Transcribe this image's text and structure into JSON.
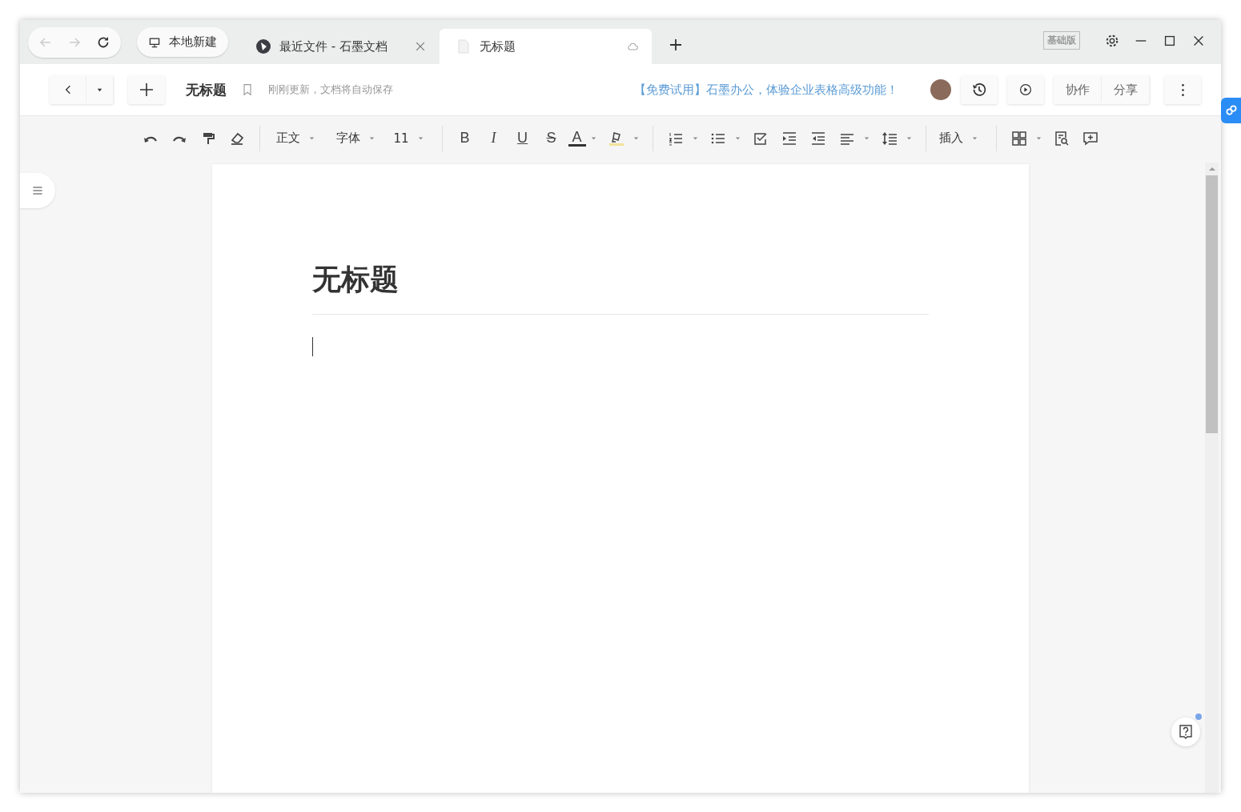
{
  "browser": {
    "home_button": "本地新建",
    "tabs": [
      {
        "title": "最近文件 - 石墨文档",
        "kind": "app",
        "selected": false
      },
      {
        "title": "无标题",
        "kind": "doc",
        "selected": true
      }
    ],
    "edition_badge": "基础版"
  },
  "doc_header": {
    "title": "无标题",
    "save_status": "刚刚更新，文档将自动保存",
    "promo": "【免费试用】石墨办公，体验企业表格高级功能！",
    "buttons": [
      "协作",
      "分享"
    ]
  },
  "toolbar": {
    "style_dropdown": "正文",
    "font_dropdown": "字体",
    "size_dropdown": "11",
    "format_buttons": [
      {
        "label": "B",
        "kind": "bold"
      },
      {
        "label": "I",
        "kind": "italic"
      },
      {
        "label": "U",
        "kind": "underline"
      },
      {
        "label": "S",
        "kind": "strike"
      },
      {
        "label": "A",
        "kind": "color"
      }
    ],
    "insert_dropdown": "插入"
  },
  "document": {
    "heading": "无标题"
  }
}
